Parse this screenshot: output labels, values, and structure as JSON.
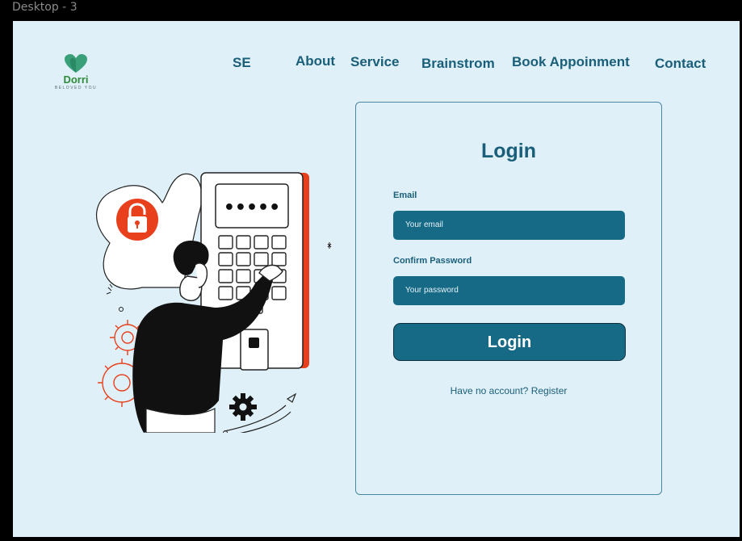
{
  "frame": {
    "label": "Desktop - 3"
  },
  "logo": {
    "brand": "Dorri",
    "tagline": "BELOVED YOU",
    "icon": "heart-icon",
    "color": "#2e8b3a"
  },
  "nav": {
    "items": [
      "SE",
      "About",
      "Service",
      "Brainstrom",
      "Book Appoinment",
      "Contact"
    ]
  },
  "login": {
    "title": "Login",
    "email_label": "Email",
    "email_placeholder": "Your email",
    "password_label": "Confirm Password",
    "password_placeholder": "Your password",
    "button_label": "Login",
    "register_prompt": "Have no account?",
    "register_link": "Register"
  },
  "illustration": {
    "keypad_display": "•••••",
    "lock_icon": "padlock-icon",
    "gear_icon": "gear-icon"
  },
  "colors": {
    "accent": "#176a85",
    "heading": "#1a5f7a",
    "background": "#dff0f8",
    "highlight": "#e8401c"
  }
}
